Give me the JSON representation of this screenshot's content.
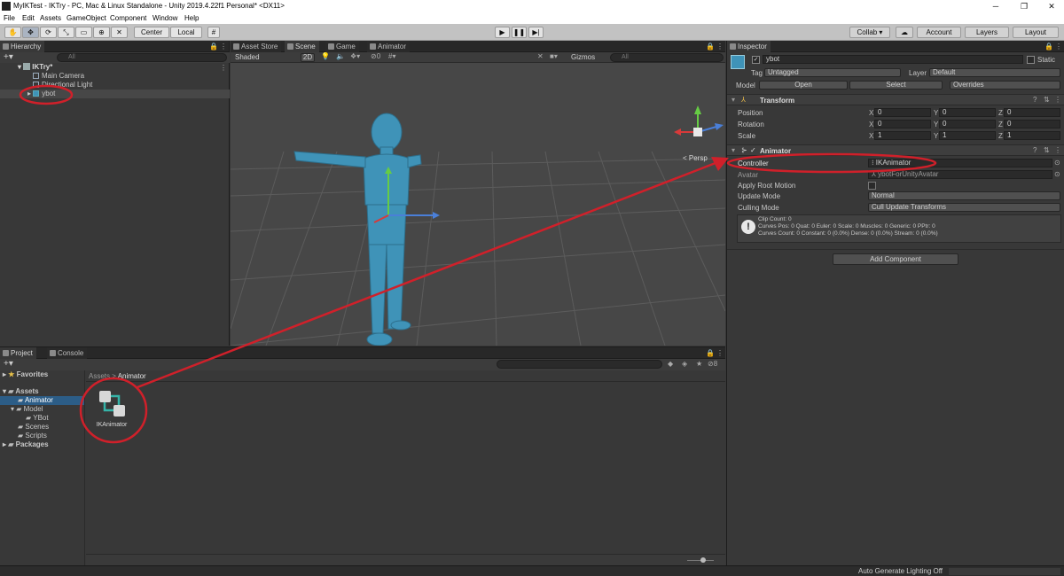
{
  "window": {
    "title": "MyIKTest - IKTry - PC, Mac & Linux Standalone - Unity 2019.4.22f1 Personal* <DX11>",
    "minimize": "─",
    "maximize": "❐",
    "close": "✕"
  },
  "menu": [
    "File",
    "Edit",
    "Assets",
    "GameObject",
    "Component",
    "Window",
    "Help"
  ],
  "toolbar": {
    "pivot": "Center",
    "space": "Local",
    "collab": "Collab ▾",
    "account": "Account",
    "layers": "Layers",
    "layout": "Layout"
  },
  "hierarchy": {
    "tab": "Hierarchy",
    "search_placeholder": "All",
    "scene": "IKTry*",
    "items": [
      "Main Camera",
      "Directional Light",
      "ybot"
    ]
  },
  "scene_view": {
    "tabs": [
      "Asset Store",
      "Scene",
      "Game",
      "Animator"
    ],
    "shading": "Shaded",
    "mode_2d": "2D",
    "hidden_count": "0",
    "gizmos": "Gizmos",
    "search_placeholder": "All",
    "persp": "< Persp"
  },
  "inspector": {
    "tab": "Inspector",
    "object_name": "ybot",
    "static_label": "Static",
    "tag_label": "Tag",
    "tag_value": "Untagged",
    "layer_label": "Layer",
    "layer_value": "Default",
    "model_label": "Model",
    "open_btn": "Open",
    "select_btn": "Select",
    "overrides_btn": "Overrides",
    "transform": {
      "title": "Transform",
      "rows": [
        {
          "label": "Position",
          "x": "0",
          "y": "0",
          "z": "0"
        },
        {
          "label": "Rotation",
          "x": "0",
          "y": "0",
          "z": "0"
        },
        {
          "label": "Scale",
          "x": "1",
          "y": "1",
          "z": "1"
        }
      ]
    },
    "animator": {
      "title": "Animator",
      "controller_label": "Controller",
      "controller_value": "IKAnimator",
      "avatar_label": "Avatar",
      "avatar_value": "ybotFor­UnityAvatar",
      "root_motion_label": "Apply Root Motion",
      "update_mode_label": "Update Mode",
      "update_mode_value": "Normal",
      "culling_label": "Culling Mode",
      "culling_value": "Cull Update Transforms",
      "info_line1": "Clip Count: 0",
      "info_line2": "Curves Pos: 0 Quat: 0 Euler: 0 Scale: 0 Muscles: 0 Generic: 0 PPtr: 0",
      "info_line3": "Curves Count: 0 Constant: 0 (0.0%) Dense: 0 (0.0%) Stream: 0 (0.0%)"
    },
    "add_component": "Add Component"
  },
  "project": {
    "tabs": [
      "Project",
      "Console"
    ],
    "favorites": "Favorites",
    "tree": [
      "Assets",
      "Animator",
      "Model",
      "YBot",
      "Scenes",
      "Scripts",
      "Packages"
    ],
    "breadcrumb_root": "Assets",
    "breadcrumb_sep": ">",
    "breadcrumb_current": "Animator",
    "asset_name": "IKAnimator",
    "hidden_count": "8"
  },
  "status": {
    "lighting": "Auto Generate Lighting Off"
  },
  "colors": {
    "annotation_red": "#d0202a",
    "selection_blue": "#2c5d87",
    "character_blue": "#3f93b8"
  }
}
